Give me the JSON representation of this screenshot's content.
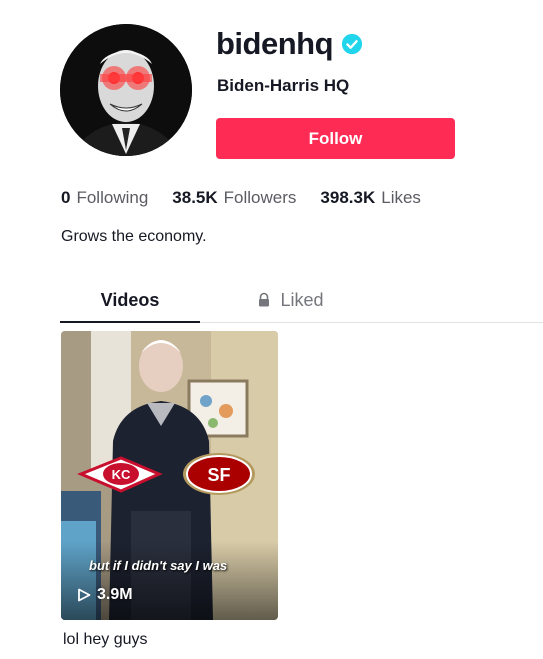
{
  "profile": {
    "username": "bidenhq",
    "display_name": "Biden-Harris HQ",
    "follow_label": "Follow",
    "bio": "Grows the economy."
  },
  "stats": [
    {
      "value": "0",
      "label": "Following"
    },
    {
      "value": "38.5K",
      "label": "Followers"
    },
    {
      "value": "398.3K",
      "label": "Likes"
    }
  ],
  "tabs": {
    "videos": "Videos",
    "liked": "Liked"
  },
  "videos": [
    {
      "caption_overlay": "but if I didn't say I was",
      "views": "3.9M",
      "title": "lol hey guys"
    }
  ],
  "colors": {
    "accent": "#fe2c55",
    "verified": "#20d5ec",
    "text": "#161823",
    "muted": "#75767c"
  },
  "icons": [
    "verified-badge-icon",
    "lock-icon",
    "play-icon"
  ]
}
